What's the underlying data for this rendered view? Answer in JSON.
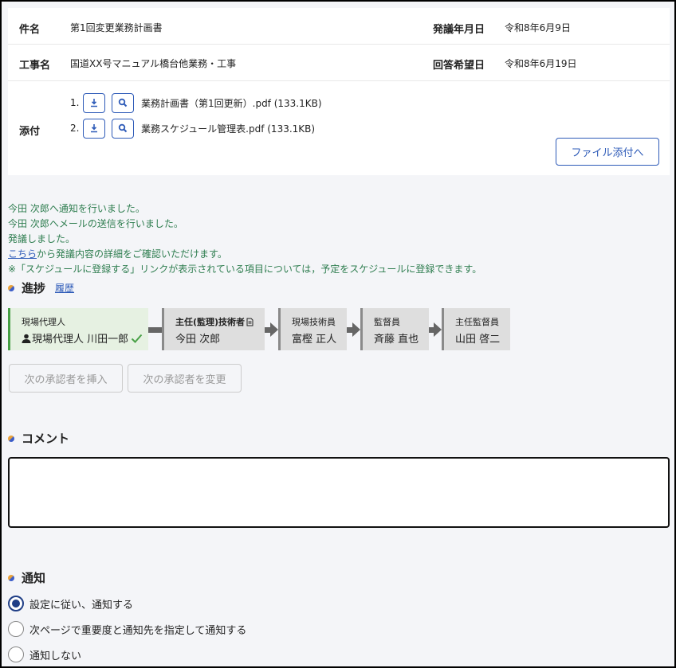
{
  "info": {
    "subject_label": "件名",
    "subject_value": "第1回変更業務計画書",
    "issue_date_label": "発議年月日",
    "issue_date_value": "令和8年6月9日",
    "project_label": "工事名",
    "project_value": "国道XX号マニュアル橋台他業務・工事",
    "reply_date_label": "回答希望日",
    "reply_date_value": "令和8年6月19日",
    "attach_label": "添付",
    "attachments": [
      {
        "num": "1.",
        "name": "業務計画書（第1回更新）.pdf (133.1KB)"
      },
      {
        "num": "2.",
        "name": "業務スケジュール管理表.pdf (133.1KB)"
      }
    ],
    "attach_button": "ファイル添付へ"
  },
  "notices": {
    "line1": "今田 次郎へ通知を行いました。",
    "line2": "今田 次郎へメールの送信を行いました。",
    "line3": "発議しました。",
    "line4_link": "こちら",
    "line4_rest": "から発議内容の詳細をご確認いただけます。",
    "line5": "※「スケジュールに登録する」リンクが表示されている項目については，予定をスケジュールに登録できます。"
  },
  "progress": {
    "title": "進捗",
    "history_link": "履歴",
    "steps": [
      {
        "role": "現場代理人",
        "who": "現場代理人 川田一郎"
      },
      {
        "role": "主任(監理)技術者",
        "who": "今田 次郎"
      },
      {
        "role": "現場技術員",
        "who": "富樫 正人"
      },
      {
        "role": "監督員",
        "who": "斉藤 直也"
      },
      {
        "role": "主任監督員",
        "who": "山田 啓二"
      }
    ],
    "insert_button": "次の承認者を挿入",
    "change_button": "次の承認者を変更"
  },
  "comment": {
    "title": "コメント",
    "value": ""
  },
  "notify": {
    "title": "通知",
    "options": [
      {
        "label": "設定に従い、通知する",
        "checked": true
      },
      {
        "label": "次ページで重要度と通知先を指定して通知する",
        "checked": false
      },
      {
        "label": "通知しない",
        "checked": false
      }
    ]
  }
}
